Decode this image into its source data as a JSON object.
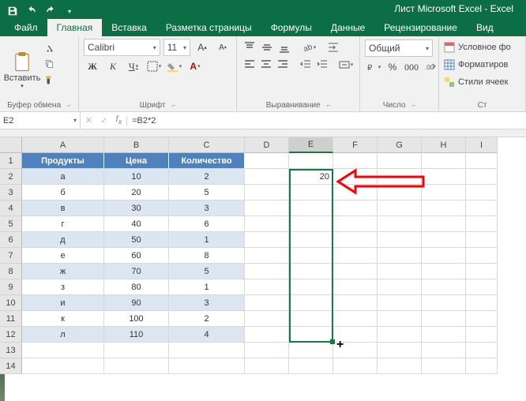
{
  "title": "Лист Microsoft Excel - Excel",
  "tabs": {
    "file": "Файл",
    "home": "Главная",
    "insert": "Вставка",
    "layout": "Разметка страницы",
    "formulas": "Формулы",
    "data": "Данные",
    "review": "Рецензирование",
    "view": "Вид"
  },
  "ribbon": {
    "clipboard": {
      "paste": "Вставить",
      "label": "Буфер обмена"
    },
    "font": {
      "name": "Calibri",
      "size": "11",
      "label": "Шрифт",
      "bold": "Ж",
      "italic": "К",
      "underline": "Ч"
    },
    "align": {
      "label": "Выравнивание"
    },
    "number": {
      "format": "Общий",
      "label": "Число"
    },
    "styles": {
      "cond": "Условное фо",
      "table": "Форматиров",
      "cell": "Стили ячеек",
      "label": "Ст"
    }
  },
  "namebox": "E2",
  "formula": "=B2*2",
  "cols": [
    "A",
    "B",
    "C",
    "D",
    "E",
    "F",
    "G",
    "H",
    "I"
  ],
  "rows": [
    "1",
    "2",
    "3",
    "4",
    "5",
    "6",
    "7",
    "8",
    "9",
    "10",
    "11",
    "12",
    "13",
    "14"
  ],
  "table": {
    "headers": [
      "Продукты",
      "Цена",
      "Количество"
    ],
    "rows": [
      {
        "p": "а",
        "c": "10",
        "q": "2"
      },
      {
        "p": "б",
        "c": "20",
        "q": "5"
      },
      {
        "p": "в",
        "c": "30",
        "q": "3"
      },
      {
        "p": "г",
        "c": "40",
        "q": "6"
      },
      {
        "p": "д",
        "c": "50",
        "q": "1"
      },
      {
        "p": "е",
        "c": "60",
        "q": "8"
      },
      {
        "p": "ж",
        "c": "70",
        "q": "5"
      },
      {
        "p": "з",
        "c": "80",
        "q": "1"
      },
      {
        "p": "и",
        "c": "90",
        "q": "3"
      },
      {
        "p": "к",
        "c": "100",
        "q": "2"
      },
      {
        "p": "л",
        "c": "110",
        "q": "4"
      }
    ]
  },
  "result_e2": "20"
}
